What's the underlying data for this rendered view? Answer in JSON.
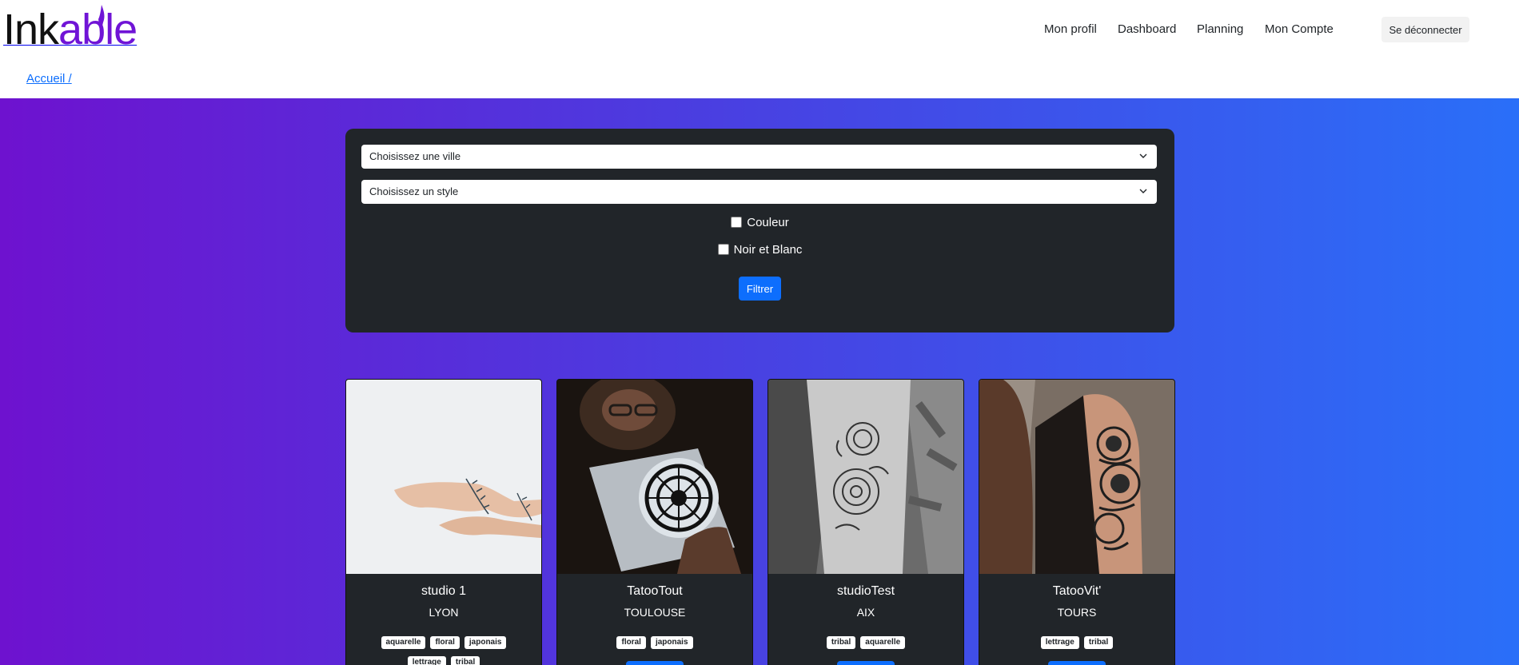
{
  "brand": {
    "logo_text_dark": "Ink",
    "logo_text_accent": "able",
    "accent_color": "#7014d6"
  },
  "nav": {
    "items": [
      "Mon profil",
      "Dashboard",
      "Planning",
      "Mon Compte"
    ],
    "logout_label": "Se déconnecter"
  },
  "breadcrumb": {
    "home": "Accueil /"
  },
  "filters": {
    "city_select": "Choisissez une ville",
    "style_select": "Choisissez un style",
    "checkbox_color": "Couleur",
    "checkbox_bw": "Noir et Blanc",
    "submit_label": "Filtrer"
  },
  "studios": [
    {
      "name": "studio 1",
      "city": "LYON",
      "tags": [
        "aquarelle",
        "floral",
        "japonais",
        "lettrage",
        "tribal"
      ],
      "image": "tattooed-wrist-photo"
    },
    {
      "name": "TatooTout",
      "city": "TOULOUSE",
      "tags": [
        "floral",
        "japonais"
      ],
      "image": "artist-drawing-mandala-photo"
    },
    {
      "name": "studioTest",
      "city": "AIX",
      "tags": [
        "tribal",
        "aquarelle"
      ],
      "image": "floral-forearm-tattoo-photo"
    },
    {
      "name": "TatooVit'",
      "city": "TOURS",
      "tags": [
        "lettrage",
        "tribal"
      ],
      "image": "floral-sleeve-tattoo-photo"
    }
  ],
  "colors": {
    "primary": "#0d6efd",
    "panel": "#212529",
    "gradient_start": "#6e12cf",
    "gradient_end": "#2a6ff8"
  }
}
